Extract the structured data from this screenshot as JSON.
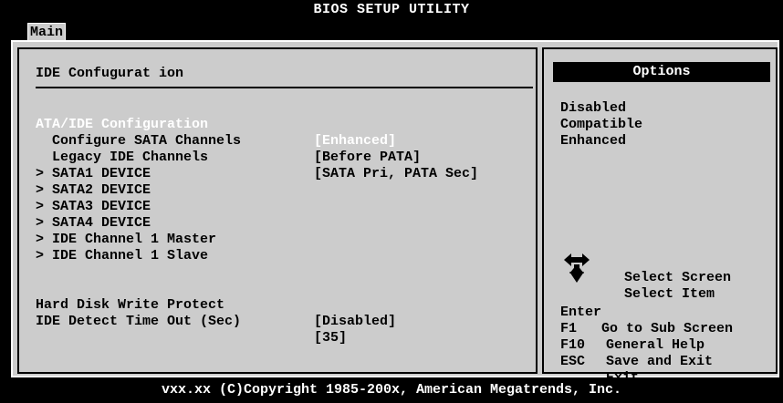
{
  "header": {
    "title": "BIOS SETUP UTILITY",
    "tab_main": "Main"
  },
  "section": {
    "title": "IDE Confugurat ion"
  },
  "settings": [
    {
      "label": "ATA/IDE Configuration",
      "value": "[Enhanced]"
    },
    {
      "label": "  Configure SATA Channels",
      "value": "[Before PATA]"
    },
    {
      "label": "  Legacy IDE Channels",
      "value": "[SATA Pri, PATA Sec]"
    }
  ],
  "submenus": [
    "> SATA1 DEVICE",
    "> SATA2 DEVICE",
    "> SATA3 DEVICE",
    "> SATA4 DEVICE",
    "> IDE Channel 1 Master",
    "> IDE Channel 1 Slave"
  ],
  "settings2": [
    {
      "label": "Hard Disk Write Protect",
      "value": "[Disabled]"
    },
    {
      "label": "IDE Detect Time Out (Sec)",
      "value": "[35]"
    }
  ],
  "options": {
    "header": "Options",
    "items": [
      "Disabled",
      "Compatible",
      "Enhanced"
    ]
  },
  "help": [
    {
      "key": "",
      "text": "Select Screen"
    },
    {
      "key": "",
      "text": "Select Item"
    },
    {
      "key": "Enter",
      "text": "Go to Sub Screen"
    },
    {
      "key": "F1",
      "text": "General Help"
    },
    {
      "key": "F10",
      "text": "Save and Exit"
    },
    {
      "key": "ESC",
      "text": "Exit"
    }
  ],
  "footer": {
    "text": "vxx.xx (C)Copyright 1985-200x, American Megatrends, Inc."
  },
  "colors": {
    "background": "#000000",
    "panel": "#cccccc",
    "highlight": "#ffffff"
  },
  "icons": {
    "arrows": "arrows-icon"
  }
}
